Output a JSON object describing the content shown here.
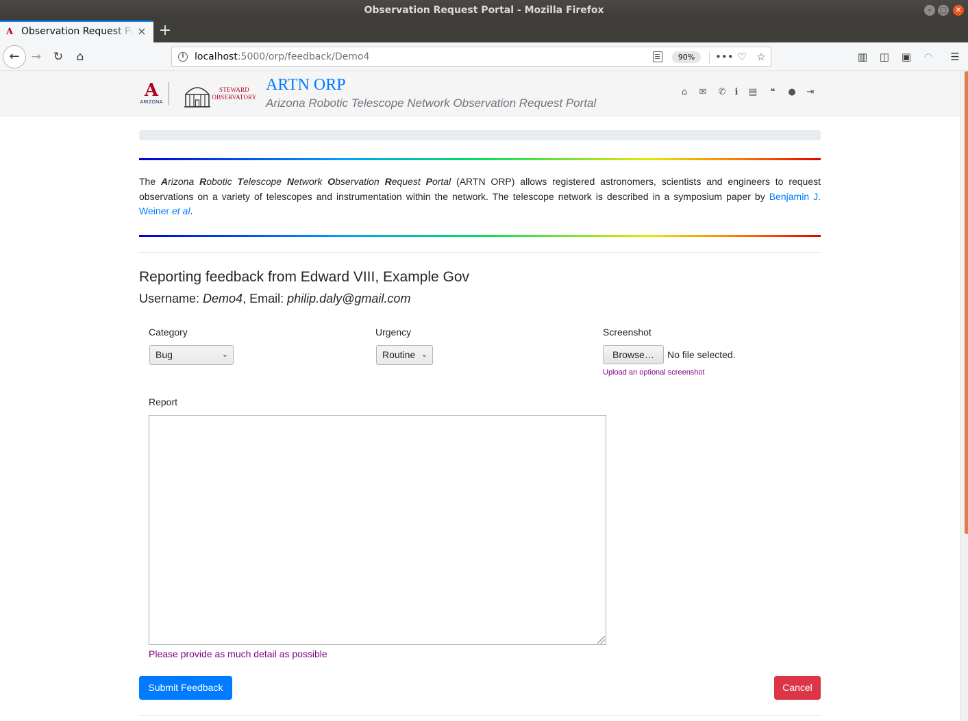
{
  "browser": {
    "window_title": "Observation Request Portal - Mozilla Firefox",
    "tab_title": "Observation Request Portal",
    "url_host": "localhost",
    "url_rest": ":5000/orp/feedback/Demo4",
    "zoom": "90%"
  },
  "header": {
    "ua_logo_letter": "A",
    "ua_logo_word": "ARIZONA",
    "steward_line1": "STEWARD",
    "steward_line2": "OBSERVATORY",
    "title": "ARTN ORP",
    "subtitle": "Arizona Robotic Telescope Network Observation Request Portal",
    "nav_icons": [
      "home-icon",
      "envelope-icon",
      "phone-icon",
      "info-icon",
      "book-icon",
      "comments-icon",
      "user-icon",
      "sign-out-icon"
    ]
  },
  "progress": {
    "value": 0
  },
  "intro": {
    "prefix": "The ",
    "words": [
      {
        "initial": "A",
        "rest": "rizona "
      },
      {
        "initial": "R",
        "rest": "obotic "
      },
      {
        "initial": "T",
        "rest": "elescope "
      },
      {
        "initial": "N",
        "rest": "etwork "
      },
      {
        "initial": "O",
        "rest": "bservation "
      },
      {
        "initial": "R",
        "rest": "equest "
      },
      {
        "initial": "P",
        "rest": "ortal"
      }
    ],
    "middle": " (ARTN ORP) allows registered astronomers, scientists and engineers to request observations on a variety of telescopes and instrumentation within the network. The telescope network is described in a symposium paper by ",
    "link_text": "Benjamin J. Weiner ",
    "link_italic": "et al",
    "suffix": "."
  },
  "feedback": {
    "heading": "Reporting feedback from Edward VIII, Example Gov",
    "username_label": "Username: ",
    "username": "Demo4",
    "email_label": ", Email: ",
    "email": "philip.daly@gmail.com"
  },
  "form": {
    "category_label": "Category",
    "category_value": "Bug",
    "urgency_label": "Urgency",
    "urgency_value": "Routine",
    "screenshot_label": "Screenshot",
    "browse_label": "Browse…",
    "no_file_text": "No file selected.",
    "screenshot_hint": "Upload an optional screenshot",
    "report_label": "Report",
    "report_value": "",
    "report_hint": "Please provide as much detail as possible",
    "submit_label": "Submit Feedback",
    "cancel_label": "Cancel"
  },
  "colors": {
    "primary": "#007bff",
    "danger": "#dc3545",
    "hint": "#800080",
    "ua_red": "#ab0520"
  }
}
